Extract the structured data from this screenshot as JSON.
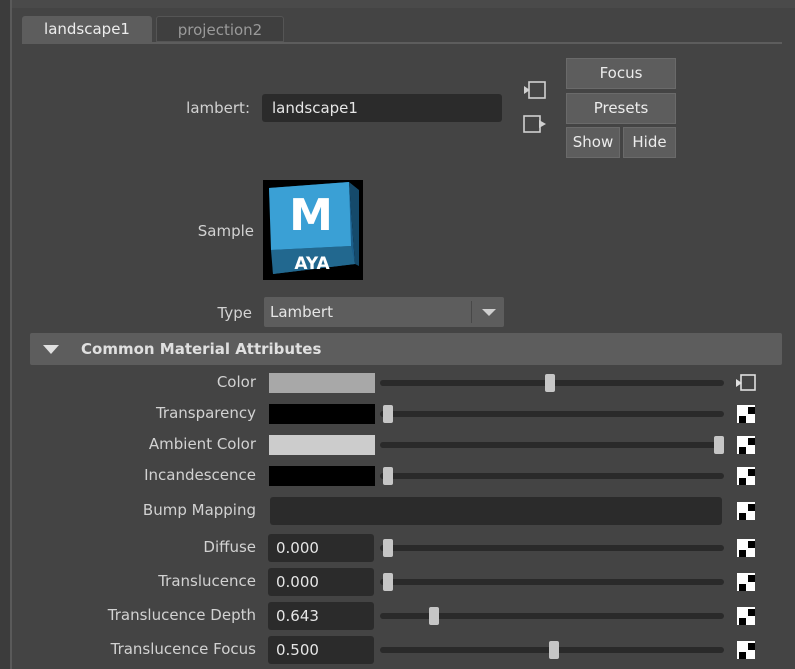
{
  "tabs": [
    {
      "label": "landscape1",
      "active": true
    },
    {
      "label": "projection2",
      "active": false
    }
  ],
  "header": {
    "node_type_label": "lambert:",
    "node_name": "landscape1",
    "buttons": {
      "focus": "Focus",
      "presets": "Presets",
      "show": "Show",
      "hide": "Hide"
    }
  },
  "sample": {
    "label": "Sample",
    "logo_letter": "M",
    "logo_text": "AYA"
  },
  "type": {
    "label": "Type",
    "selected": "Lambert"
  },
  "section": {
    "title": "Common Material Attributes",
    "expanded": true
  },
  "attributes": [
    {
      "label": "Color",
      "kind": "color",
      "swatch": "#a8a8a8",
      "slider": 0.49,
      "map": "input"
    },
    {
      "label": "Transparency",
      "kind": "color",
      "swatch": "#000000",
      "slider": 0.0,
      "map": "checker"
    },
    {
      "label": "Ambient Color",
      "kind": "color",
      "swatch": "#cccccc",
      "slider": 1.0,
      "map": "checker"
    },
    {
      "label": "Incandescence",
      "kind": "color",
      "swatch": "#000000",
      "slider": 0.0,
      "map": "checker"
    },
    {
      "label": "Bump Mapping",
      "kind": "map",
      "map": "checker"
    },
    {
      "label": "Diffuse",
      "kind": "number",
      "value": "0.000",
      "slider": 0.0,
      "map": "checker"
    },
    {
      "label": "Translucence",
      "kind": "number",
      "value": "0.000",
      "slider": 0.0,
      "map": "checker"
    },
    {
      "label": "Translucence Depth",
      "kind": "number",
      "value": "0.643",
      "slider": 0.14,
      "map": "checker"
    },
    {
      "label": "Translucence Focus",
      "kind": "number",
      "value": "0.500",
      "slider": 0.5,
      "map": "checker"
    }
  ],
  "colors": {
    "panel": "#444444",
    "field": "#2b2b2b",
    "button": "#5d5d5d",
    "logo_blue": "#3aa0d5"
  }
}
